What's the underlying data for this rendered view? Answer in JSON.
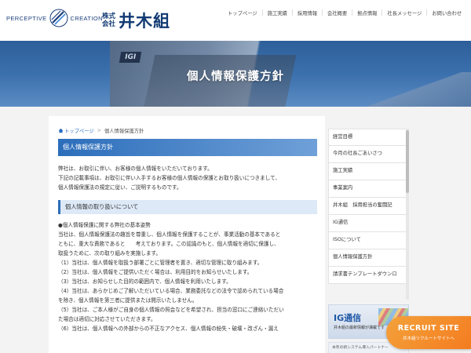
{
  "header": {
    "logo_left_a": "PERCEPTIVE",
    "logo_left_b": "CREATION",
    "company_prefix_1": "株式",
    "company_prefix_2": "会社",
    "company_name": "井木組",
    "brand_color": "#123a73",
    "nav": [
      {
        "label": "トップページ"
      },
      {
        "label": "施工実績"
      },
      {
        "label": "採用情報"
      },
      {
        "label": "会社概要"
      },
      {
        "label": "拠点情報"
      },
      {
        "label": "社長メッセージ"
      },
      {
        "label": "お問い合わせ"
      }
    ]
  },
  "hero": {
    "title": "個人情報保護方針",
    "sign_text": "IGI"
  },
  "breadcrumb": {
    "home_label": "トップページ",
    "separator": ">",
    "current": "個人情報保護方針"
  },
  "main": {
    "page_heading": "個人情報保護方針",
    "intro": [
      "弊社は、お取引に伴い、お客様の個人情報をいただいております。",
      "下記の記載事項は、お取引に伴い入手するお客様の個人情報の保護とお取り扱いにつきまして、",
      "個人情報保護法の規定に従い、ご説明するものです。"
    ],
    "section_heading": "個人情報の取り扱いについて",
    "section_lead": "●個人情報保護に関する弊社の基本姿勢",
    "section_body": [
      "当社は、個人情報保護法の趣旨を尊重し、個人情報を保護することが、事業活動の基本であると",
      "ともに、重大な責務であると　　考えております。この認識のもと、個人情報を適切に保護し、",
      "取扱うために、次の取り組みを実施します。",
      "（1）当社は、個人情報を取扱う部署ごとに管理者を置き、適切な管理に取り組みます。",
      "（2）当社は、個人情報をご提供いただく場合は、利用目的をお知らせいたします。",
      "（3）当社は、お知らせした目的の範囲内で、個人情報を利用いたします。",
      "（4）当社は、あらかじめご了解いただいている場合、業務委託などの法令で認められている場合",
      "を除き、個人情報を第三者に提供または開示いたしません。",
      "（5）当社は、ご本人様がご自身の個人情報の照会などを希望され、担当の窓口にご連絡いただい",
      "た場合は適切に対応させていただきます。",
      "（6）当社は、個人情報への外部からの不正なアクセス、個人情報の紛失・破壊・改ざん・漏え"
    ]
  },
  "sidebar": {
    "items": [
      {
        "label": "経営目標"
      },
      {
        "label": "今月の社長ごあいさつ"
      },
      {
        "label": "施工実績"
      },
      {
        "label": "事業案内"
      },
      {
        "label": "井木組　採用担当の奮闘記"
      },
      {
        "label": "IG通信"
      },
      {
        "label": "ISOについて"
      },
      {
        "label": "個人情報保護方針"
      },
      {
        "label": "請求書テンプレートダウンロ"
      }
    ],
    "ig_banner_title": "IG通信",
    "ig_banner_sub": "井木組の最新情報が満載です",
    "system_banner_text": "本年の新システム導入パートナー"
  },
  "recruit": {
    "title": "RECRUIT SITE",
    "sub": "井木組リクルートサイトへ"
  },
  "colors": {
    "accent_blue": "#2c6ebb",
    "recruit_orange": "#f47c20"
  }
}
